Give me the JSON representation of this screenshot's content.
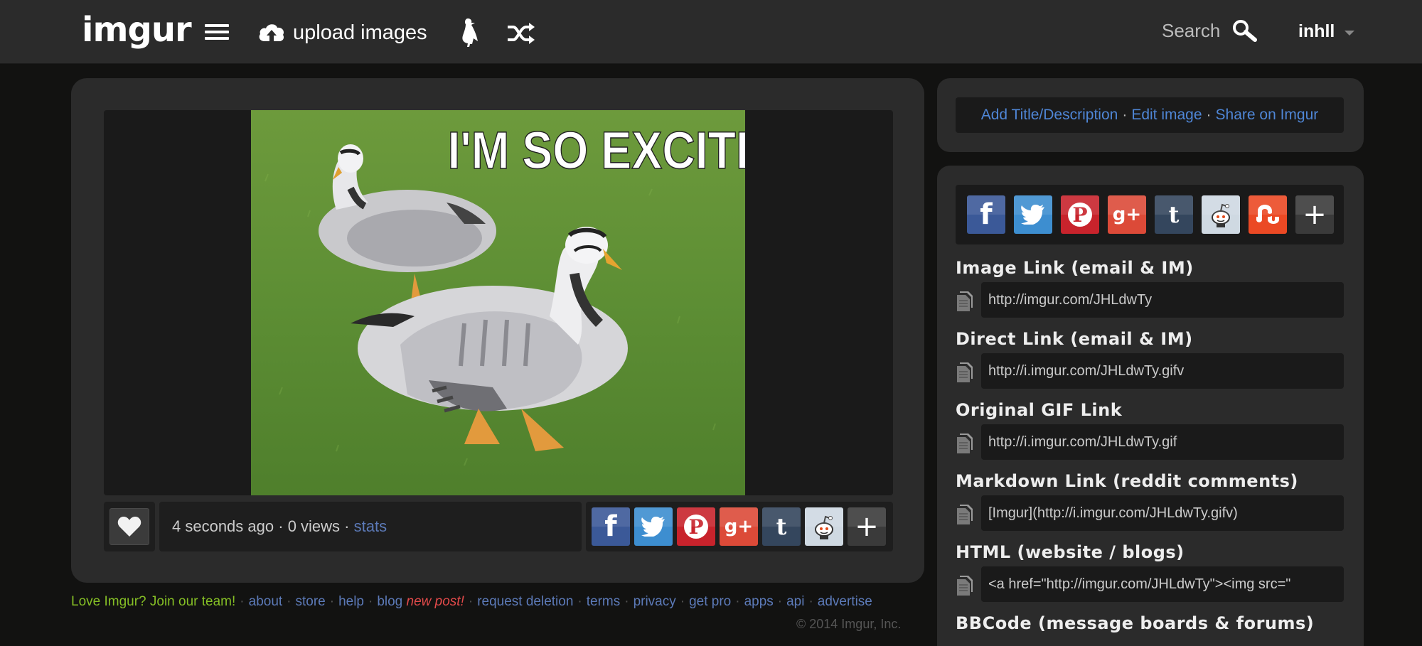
{
  "header": {
    "logo": "imgur",
    "upload_label": "upload images",
    "search_label": "Search",
    "username": "inhll"
  },
  "image": {
    "caption": "I'M SO EXCITED",
    "posted_time": "4 seconds ago",
    "sep1": "·",
    "views": "0 views",
    "sep2": "·",
    "stats_label": "stats"
  },
  "share_icons": [
    "facebook-icon",
    "twitter-icon",
    "pinterest-icon",
    "google-plus-icon",
    "tumblr-icon",
    "reddit-icon",
    "stumbleupon-icon",
    "plus-icon"
  ],
  "colors": {
    "facebook": "#3b5998",
    "twitter": "#3d8ed0",
    "pinterest": "#c8232c",
    "google_plus": "#dc4a38",
    "tumblr": "#34465d",
    "reddit": "#cfd9e2",
    "stumbleupon": "#eb4924",
    "more": "#3a3a3a",
    "link_blue": "#4f86d6",
    "join_green": "#85bf25",
    "new_post_red": "#e24a4a"
  },
  "side_links": {
    "add_title": "Add Title/Description",
    "dot1": "·",
    "edit_image": "Edit image",
    "dot2": "·",
    "share_imgur": "Share on Imgur"
  },
  "links": [
    {
      "title": "Image Link (email & IM)",
      "value": "http://imgur.com/JHLdwTy"
    },
    {
      "title": "Direct Link (email & IM)",
      "value": "http://i.imgur.com/JHLdwTy.gifv"
    },
    {
      "title": "Original GIF Link",
      "value": "http://i.imgur.com/JHLdwTy.gif"
    },
    {
      "title": "Markdown Link (reddit comments)",
      "value": "[Imgur](http://i.imgur.com/JHLdwTy.gifv)"
    },
    {
      "title": "HTML (website / blogs)",
      "value": "<a href=\"http://imgur.com/JHLdwTy\"><img src=\""
    },
    {
      "title": "BBCode (message boards & forums)",
      "value": ""
    }
  ],
  "footer": {
    "join": "Love Imgur? Join our team!",
    "about": "about",
    "store": "store",
    "help": "help",
    "blog": "blog",
    "new_post": "new post!",
    "request_deletion": "request deletion",
    "terms": "terms",
    "privacy": "privacy",
    "get_pro": "get pro",
    "apps": "apps",
    "api": "api",
    "advertise": "advertise",
    "sep": "·",
    "copyright": "© 2014 Imgur, Inc."
  }
}
